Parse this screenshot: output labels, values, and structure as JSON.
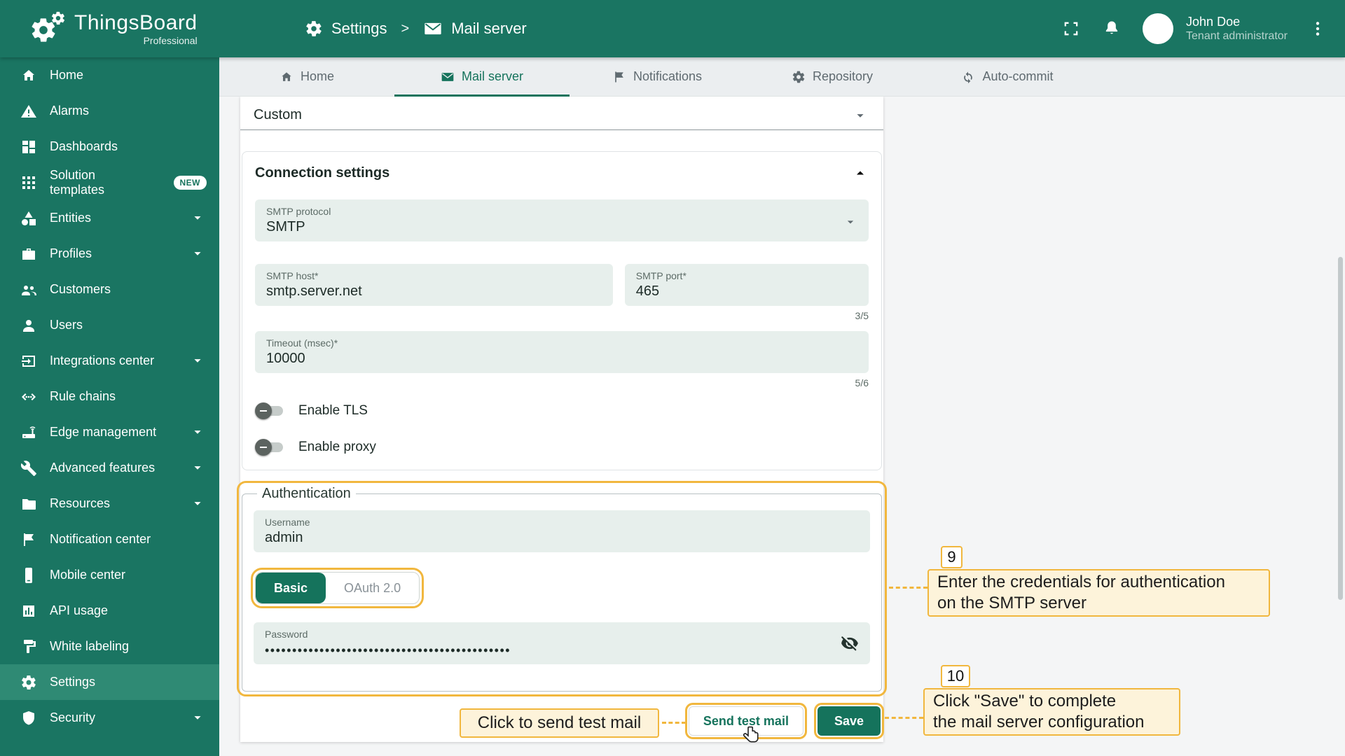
{
  "app": {
    "name": "ThingsBoard",
    "edition": "Professional"
  },
  "header": {
    "breadcrumb": {
      "section": "Settings",
      "separator": ">",
      "page": "Mail server"
    },
    "user": {
      "name": "John Doe",
      "role": "Tenant administrator"
    }
  },
  "sidebar": {
    "items": [
      {
        "label": "Home",
        "icon": "home"
      },
      {
        "label": "Alarms",
        "icon": "warning"
      },
      {
        "label": "Dashboards",
        "icon": "dashboard"
      },
      {
        "label": "Solution templates",
        "icon": "apps",
        "badge": "NEW"
      },
      {
        "label": "Entities",
        "icon": "category",
        "expandable": true
      },
      {
        "label": "Profiles",
        "icon": "briefcase",
        "expandable": true
      },
      {
        "label": "Customers",
        "icon": "people"
      },
      {
        "label": "Users",
        "icon": "person"
      },
      {
        "label": "Integrations center",
        "icon": "input",
        "expandable": true
      },
      {
        "label": "Rule chains",
        "icon": "settings-ethernet"
      },
      {
        "label": "Edge management",
        "icon": "router",
        "expandable": true
      },
      {
        "label": "Advanced features",
        "icon": "wrench",
        "expandable": true
      },
      {
        "label": "Resources",
        "icon": "folder",
        "expandable": true
      },
      {
        "label": "Notification center",
        "icon": "flag"
      },
      {
        "label": "Mobile center",
        "icon": "phone"
      },
      {
        "label": "API usage",
        "icon": "chart"
      },
      {
        "label": "White labeling",
        "icon": "paint"
      },
      {
        "label": "Settings",
        "icon": "gear",
        "active": true
      },
      {
        "label": "Security",
        "icon": "shield",
        "expandable": true
      }
    ]
  },
  "tabs": [
    {
      "label": "Home"
    },
    {
      "label": "Mail server",
      "active": true
    },
    {
      "label": "Notifications"
    },
    {
      "label": "Repository"
    },
    {
      "label": "Auto-commit"
    }
  ],
  "form": {
    "provider": {
      "value": "Custom"
    },
    "connection": {
      "title": "Connection settings",
      "protocol": {
        "label": "SMTP protocol",
        "value": "SMTP"
      },
      "host": {
        "label": "SMTP host*",
        "value": "smtp.server.net"
      },
      "port": {
        "label": "SMTP port*",
        "value": "465",
        "counter": "3/5"
      },
      "timeout": {
        "label": "Timeout (msec)*",
        "value": "10000",
        "counter": "5/6"
      },
      "tls": {
        "label": "Enable TLS",
        "enabled": false
      },
      "proxy": {
        "label": "Enable proxy",
        "enabled": false
      }
    },
    "auth": {
      "title": "Authentication",
      "username": {
        "label": "Username",
        "value": "admin"
      },
      "method": {
        "basic": "Basic",
        "oauth": "OAuth 2.0",
        "selected": "Basic"
      },
      "password": {
        "label": "Password",
        "value": "•••••••••••••••••••••••••••••••••••••••••••••"
      }
    },
    "actions": {
      "send_test": "Send test mail",
      "save": "Save"
    }
  },
  "annotations": {
    "step9": {
      "num": "9",
      "line1": "Enter the credentials for authentication",
      "line2": "on the SMTP server"
    },
    "step10": {
      "num": "10",
      "line1": "Click \"Save\" to complete",
      "line2": "the mail server configuration"
    },
    "hint": "Click to send test mail"
  },
  "colors": {
    "primary": "#1a7562",
    "tab_active": "#15735c",
    "annotation": "#f1b73e",
    "annotation_bg": "#fdf3da",
    "save_button": "#15735c"
  }
}
